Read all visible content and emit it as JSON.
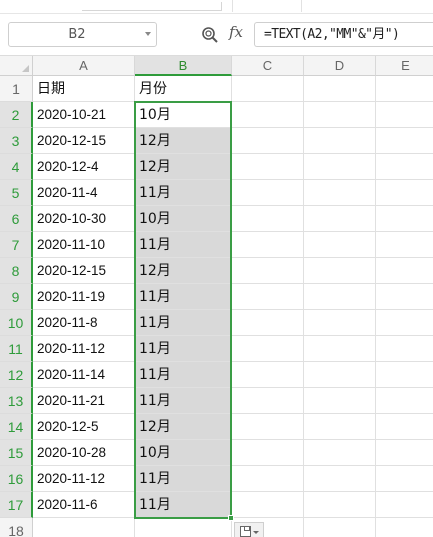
{
  "formula_bar": {
    "name_box": "B2",
    "fx_label": "fx",
    "formula": "=TEXT(A2,\"MM\"&\"月\")"
  },
  "columns": [
    "A",
    "B",
    "C",
    "D",
    "E"
  ],
  "row_numbers": [
    "1",
    "2",
    "3",
    "4",
    "5",
    "6",
    "7",
    "8",
    "9",
    "10",
    "11",
    "12",
    "13",
    "14",
    "15",
    "16",
    "17",
    "18"
  ],
  "headers": {
    "a": "日期",
    "b": "月份"
  },
  "rows": [
    {
      "date": "2020-10-21",
      "month": "10月"
    },
    {
      "date": "2020-12-15",
      "month": "12月"
    },
    {
      "date": "2020-12-4",
      "month": "12月"
    },
    {
      "date": "2020-11-4",
      "month": "11月"
    },
    {
      "date": "2020-10-30",
      "month": "10月"
    },
    {
      "date": "2020-11-10",
      "month": "11月"
    },
    {
      "date": "2020-12-15",
      "month": "12月"
    },
    {
      "date": "2020-11-19",
      "month": "11月"
    },
    {
      "date": "2020-11-8",
      "month": "11月"
    },
    {
      "date": "2020-11-12",
      "month": "11月"
    },
    {
      "date": "2020-11-14",
      "month": "11月"
    },
    {
      "date": "2020-11-21",
      "month": "11月"
    },
    {
      "date": "2020-12-5",
      "month": "12月"
    },
    {
      "date": "2020-10-28",
      "month": "10月"
    },
    {
      "date": "2020-11-12",
      "month": "11月"
    },
    {
      "date": "2020-11-6",
      "month": "11月"
    }
  ],
  "colors": {
    "selection": "#3a9d45",
    "selected_fill": "#d9d9d9"
  },
  "icons": {
    "zoom": "magnifier-icon",
    "paste_options": "paste-options-icon"
  }
}
